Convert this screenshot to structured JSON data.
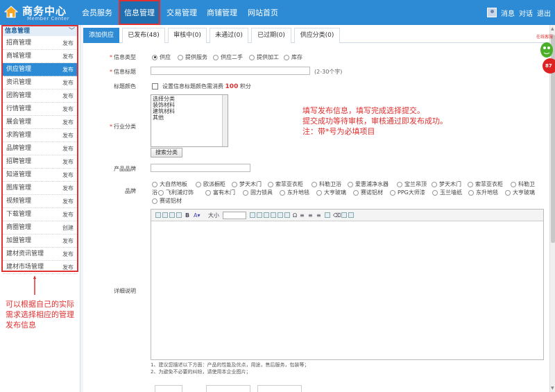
{
  "app": {
    "title": "商务中心",
    "subtitle": "Member Center"
  },
  "nav": {
    "tabs": [
      {
        "label": "会员服务"
      },
      {
        "label": "信息管理"
      },
      {
        "label": "交易管理"
      },
      {
        "label": "商铺管理"
      },
      {
        "label": "网站首页"
      }
    ],
    "user_links": [
      "消息",
      "对话",
      "退出"
    ]
  },
  "sidebar": {
    "header": "信息管理",
    "items": [
      {
        "label": "招商管理",
        "action": "发布"
      },
      {
        "label": "商城管理",
        "action": "发布"
      },
      {
        "label": "供应管理",
        "action": "发布"
      },
      {
        "label": "资讯管理",
        "action": "发布"
      },
      {
        "label": "团购管理",
        "action": "发布"
      },
      {
        "label": "行情管理",
        "action": "发布"
      },
      {
        "label": "展会管理",
        "action": "发布"
      },
      {
        "label": "求购管理",
        "action": "发布"
      },
      {
        "label": "品牌管理",
        "action": "发布"
      },
      {
        "label": "招聘管理",
        "action": "发布"
      },
      {
        "label": "知道管理",
        "action": "发布"
      },
      {
        "label": "图库管理",
        "action": "发布"
      },
      {
        "label": "视频管理",
        "action": "发布"
      },
      {
        "label": "下载管理",
        "action": "发布"
      },
      {
        "label": "商圈管理",
        "action": "创建"
      },
      {
        "label": "加盟管理",
        "action": "发布"
      },
      {
        "label": "建材资讯管理",
        "action": "发布"
      },
      {
        "label": "建材市场管理",
        "action": "发布"
      }
    ],
    "note": "可以根据自己的实际需求选择相应的管理发布信息"
  },
  "subtabs": [
    "添加供应",
    "已发布(48)",
    "审核中(0)",
    "未通过(0)",
    "已过期(0)",
    "供应分类(0)"
  ],
  "form": {
    "type_label": "信息类型",
    "type_options": [
      "供应",
      "提供服务",
      "供应二手",
      "提供加工",
      "库存"
    ],
    "title_label": "信息标题",
    "title_hint": "(2-30个字)",
    "title_value": "",
    "color_label": "标题颜色",
    "color_text_before": "设置信息标题颜色需消费",
    "color_points": "100",
    "color_text_after": "积分",
    "industry_label": "行业分类",
    "industry_options": [
      "选择分类",
      "装饰材料",
      "建筑材料",
      "其他"
    ],
    "search_category_btn": "搜索分类",
    "product_brand_label": "产品品牌",
    "brand_label": "品牌",
    "brands": [
      "大自然地板",
      "欧派橱柜",
      "梦天木门",
      "索菲亚衣柜",
      "科勒卫浴",
      "爱惠浦净水器",
      "宝兰吊顶",
      "梦天木门",
      "索菲亚衣柜",
      "科勒卫",
      "浴",
      "飞利浦灯饰",
      "富有木门",
      "固力锁具",
      "东升地毯",
      "大亨玻璃",
      "赛诺铝材",
      "PPG大师漆",
      "玉兰墙纸",
      "东升地毯",
      "大亨玻璃",
      "赛诺铝材"
    ],
    "editor_font_size_label": "大小",
    "detail_label": "详细说明",
    "footer_lines": [
      "1、建议您描述以下方面：产品的性能及优点，用途，售后服务，包装等；",
      "2、为避免不必要的纠纷，请使用本企业图片；"
    ]
  },
  "notice": [
    "填写发布信息，填写完成选择提交。",
    "提交成功等待审核，审核通过即发布成功。",
    "注：带*号为必填项目"
  ],
  "float_badge": {
    "label": "在线客服",
    "number": "87"
  }
}
